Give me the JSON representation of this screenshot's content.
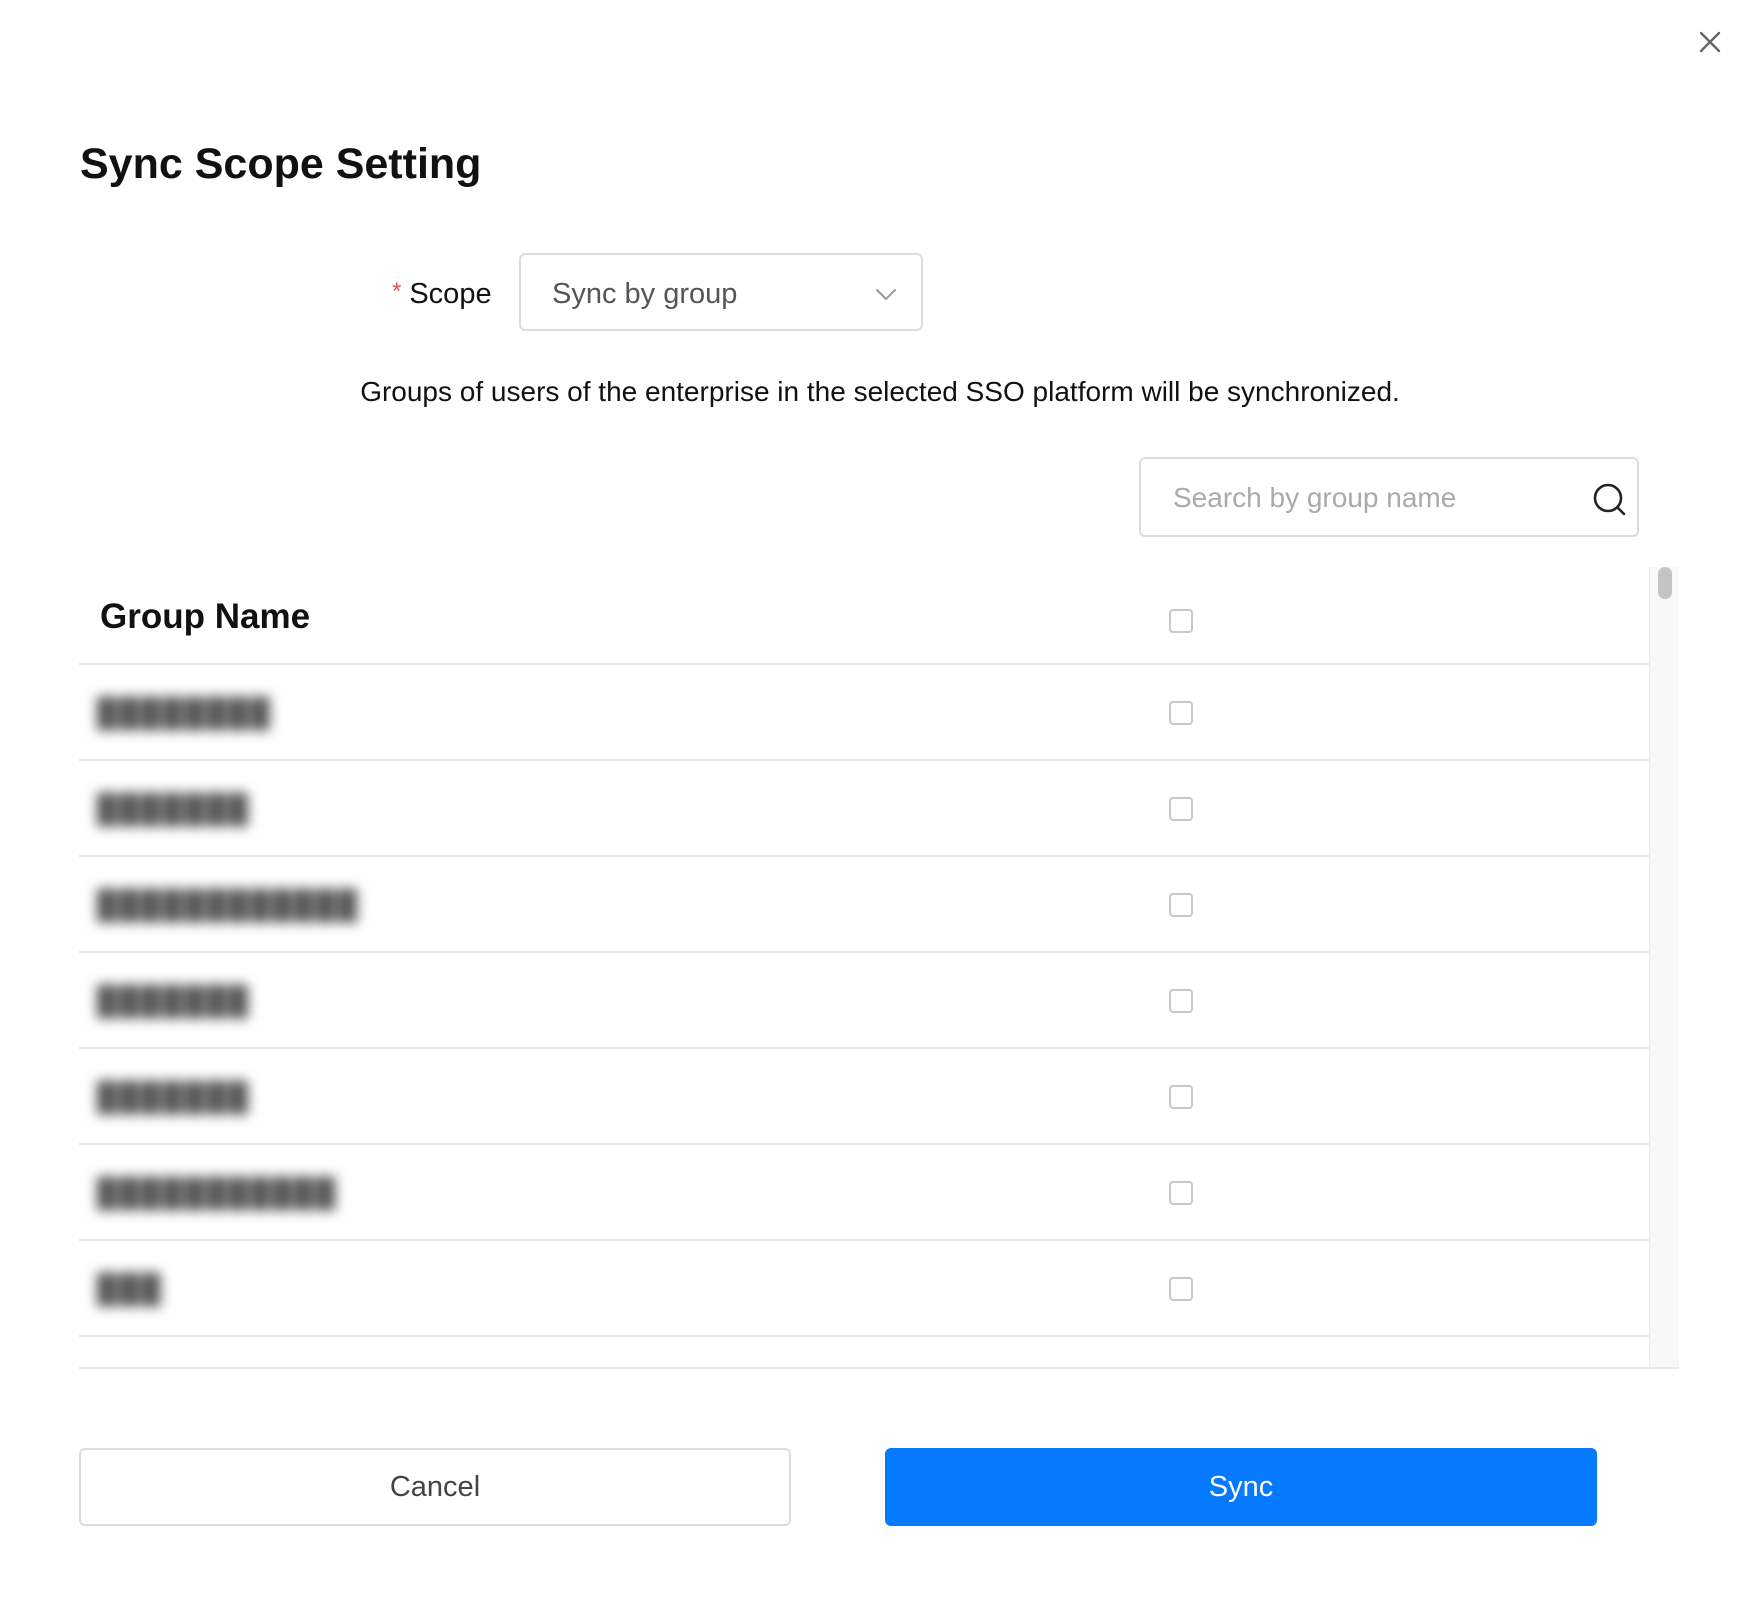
{
  "dialog": {
    "title": "Sync Scope Setting",
    "close_icon": "close-icon"
  },
  "scope": {
    "required_mark": "*",
    "label": "Scope",
    "selected": "Sync by group"
  },
  "description": "Groups of users of the enterprise in the selected SSO platform will be synchronized.",
  "search": {
    "placeholder": "Search by group name"
  },
  "table": {
    "header": "Group Name",
    "rows": [
      {
        "name": "████████",
        "checked": false
      },
      {
        "name": "███████",
        "checked": false
      },
      {
        "name": "████████████",
        "checked": false
      },
      {
        "name": "███████",
        "checked": false
      },
      {
        "name": "███████",
        "checked": false
      },
      {
        "name": "███████████",
        "checked": false
      },
      {
        "name": "███",
        "checked": false
      }
    ]
  },
  "footer": {
    "cancel_label": "Cancel",
    "sync_label": "Sync"
  },
  "colors": {
    "primary": "#0579ff",
    "required": "#e34d59"
  }
}
